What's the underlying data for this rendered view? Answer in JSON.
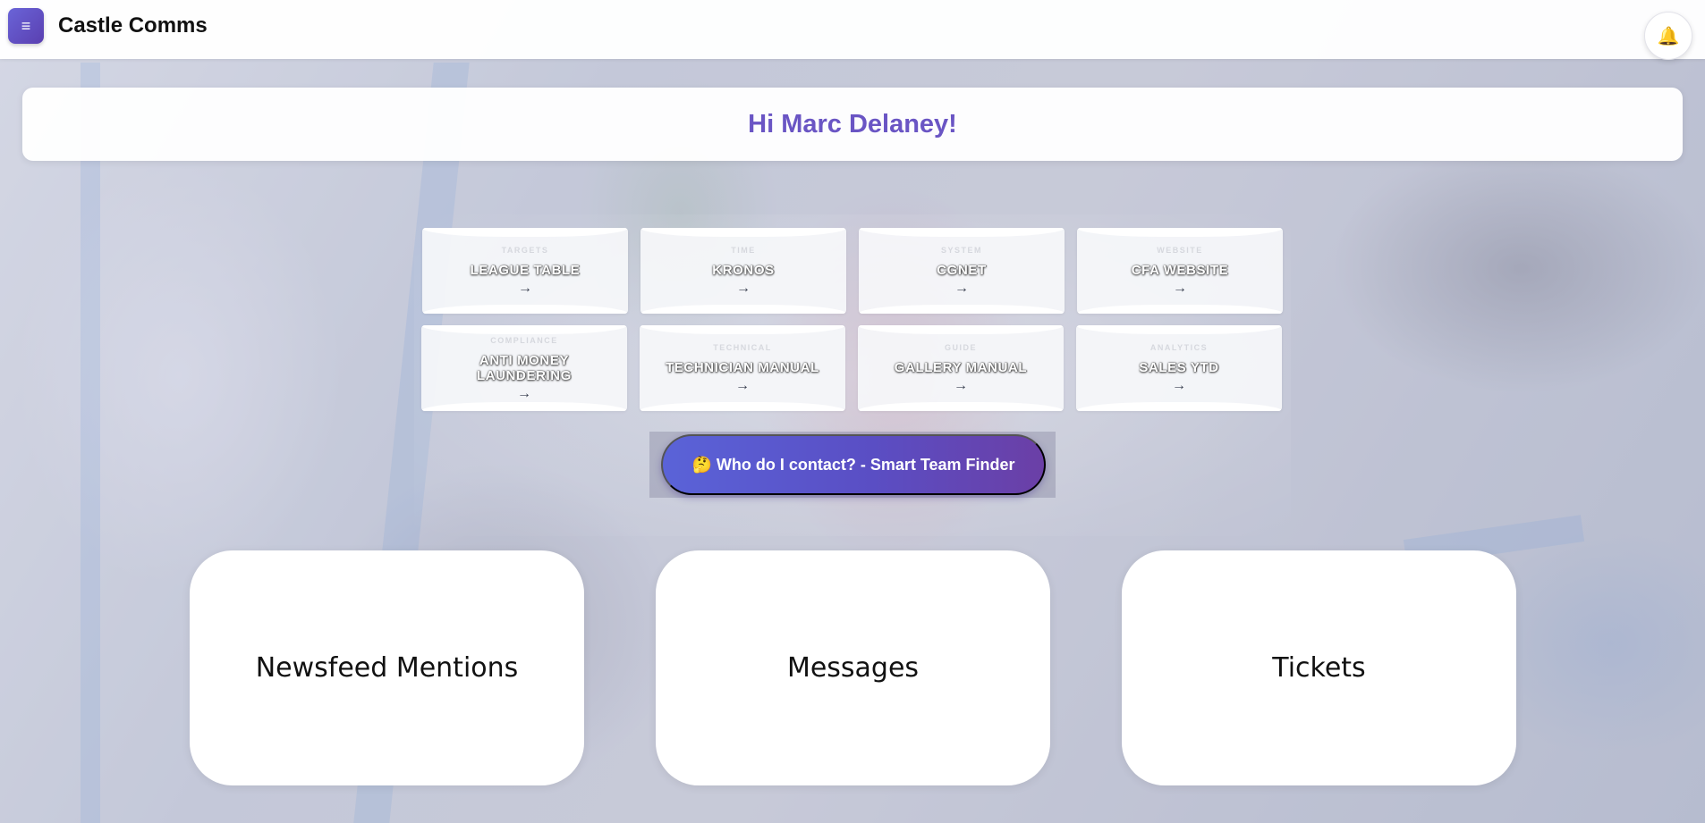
{
  "header": {
    "menu_icon": "≡",
    "app_title": "Castle Comms",
    "bell_icon": "🔔"
  },
  "greeting": "Hi Marc Delaney!",
  "tiles": [
    {
      "category": "TARGETS",
      "name": "LEAGUE TABLE",
      "arrow": "→"
    },
    {
      "category": "TIME",
      "name": "KRONOS",
      "arrow": "→"
    },
    {
      "category": "SYSTEM",
      "name": "CGNET",
      "arrow": "→"
    },
    {
      "category": "WEBSITE",
      "name": "CFA WEBSITE",
      "arrow": "→"
    },
    {
      "category": "COMPLIANCE",
      "name": "ANTI MONEY LAUNDERING",
      "arrow": "→"
    },
    {
      "category": "TECHNICAL",
      "name": "TECHNICIAN MANUAL",
      "arrow": "→"
    },
    {
      "category": "GUIDE",
      "name": "GALLERY MANUAL",
      "arrow": "→"
    },
    {
      "category": "ANALYTICS",
      "name": "SALES YTD",
      "arrow": "→"
    }
  ],
  "team_finder_label": "🤔 Who do I contact? - Smart Team Finder",
  "cards": {
    "newsfeed": "Newsfeed Mentions",
    "messages": "Messages",
    "tickets": "Tickets"
  },
  "colors": {
    "accent": "#6a55c4",
    "finder_start": "#5a63d8",
    "finder_end": "#6b3fa6"
  }
}
